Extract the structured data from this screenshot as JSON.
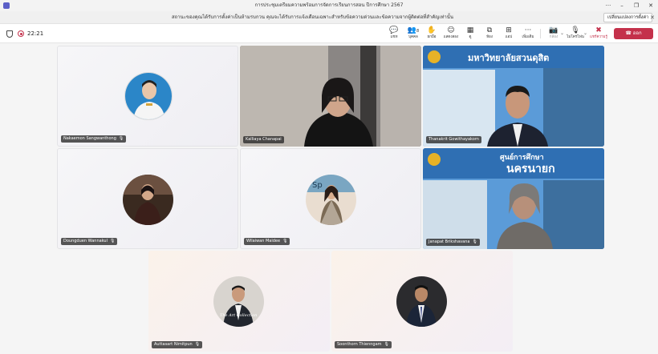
{
  "window": {
    "title": "การประชุมเตรียมความพร้อมการจัดการเรียนการสอน ปีการศึกษา 2567",
    "controls": [
      "···",
      "–",
      "❐",
      "✕"
    ]
  },
  "banner": {
    "message": "สถานะของคุณได้รับการตั้งค่าเป็นห้ามรบกวน คุณจะได้รับการแจ้งเตือนเฉพาะสำหรับข้อความด่วนและข้อความจากผู้ติดต่อที่สำคัญเท่านั้น",
    "button": "เปลี่ยนแปลงการตั้งค่า",
    "close": "✕"
  },
  "toolbar": {
    "timer": "22:21",
    "items": [
      {
        "name": "chat",
        "icon": "💬",
        "label": "แชท"
      },
      {
        "name": "people",
        "icon": "👥",
        "label": "บุคคล",
        "badge": "8"
      },
      {
        "name": "raise-hand",
        "icon": "✋",
        "label": "ยกมือ"
      },
      {
        "name": "react",
        "icon": "☺",
        "label": "แสดงสอง"
      },
      {
        "name": "view",
        "icon": "▦",
        "label": "ดู"
      },
      {
        "name": "rooms",
        "icon": "⧉",
        "label": "ห้อง"
      },
      {
        "name": "apps",
        "icon": "⊞",
        "label": "แอป"
      },
      {
        "name": "more",
        "icon": "···",
        "label": "เพิ่มเติม"
      },
      {
        "name": "camera",
        "icon": "📷",
        "label": "กล้อง"
      },
      {
        "name": "mic",
        "icon": "🎙",
        "label": "ไมโครโฟน"
      },
      {
        "name": "share",
        "icon": "✖",
        "label": "แชร์ความรู้"
      }
    ],
    "leave_label": "ออก"
  },
  "participants": [
    {
      "name": "Nakaemon Sangwanthong"
    },
    {
      "name": "Kalliaya Chanapai"
    },
    {
      "name": "Thanakrit Gowithayakorn"
    },
    {
      "name": "Doungduen Wannakul"
    },
    {
      "name": "Wilaiwan Maidee"
    },
    {
      "name": "Janapat Brikshavana"
    },
    {
      "name": "Auttasart Nimitpun"
    },
    {
      "name": "Soonthorn Thienngam"
    }
  ],
  "video_text": {
    "university": "มหาวิทยาลัยสวนดุสิต",
    "center": "ศูนย์การศึกษา",
    "city": "นครนายก"
  },
  "colors": {
    "accent": "#5b5fc7",
    "leave": "#c4314b"
  }
}
